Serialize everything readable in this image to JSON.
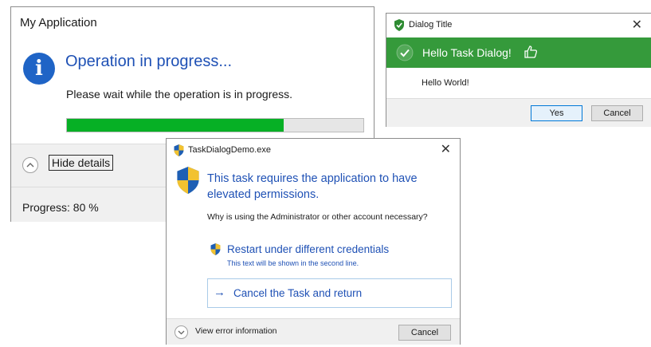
{
  "app_window": {
    "title": "My Application",
    "heading": "Operation in progress...",
    "description": "Please wait while the operation is in progress.",
    "progress_fraction": 0.73,
    "hide_details_label": "Hide details",
    "progress_text": "Progress: 80 %",
    "icon": "info-icon"
  },
  "dialog_window": {
    "title": "Dialog Title",
    "banner_text": "Hello Task Dialog!",
    "body_text": "Hello World!",
    "yes_label": "Yes",
    "cancel_label": "Cancel",
    "banner_color": "#359a3b"
  },
  "task_window": {
    "title": "TaskDialogDemo.exe",
    "heading": "This task requires the application to have elevated permissions.",
    "question": "Why is using the Administrator or other account necessary?",
    "command1_label": "Restart under different credentials",
    "command1_sub": "This text will be shown in the second line.",
    "command2_label": "Cancel the Task and return",
    "error_info_label": "View error information",
    "cancel_label": "Cancel"
  }
}
